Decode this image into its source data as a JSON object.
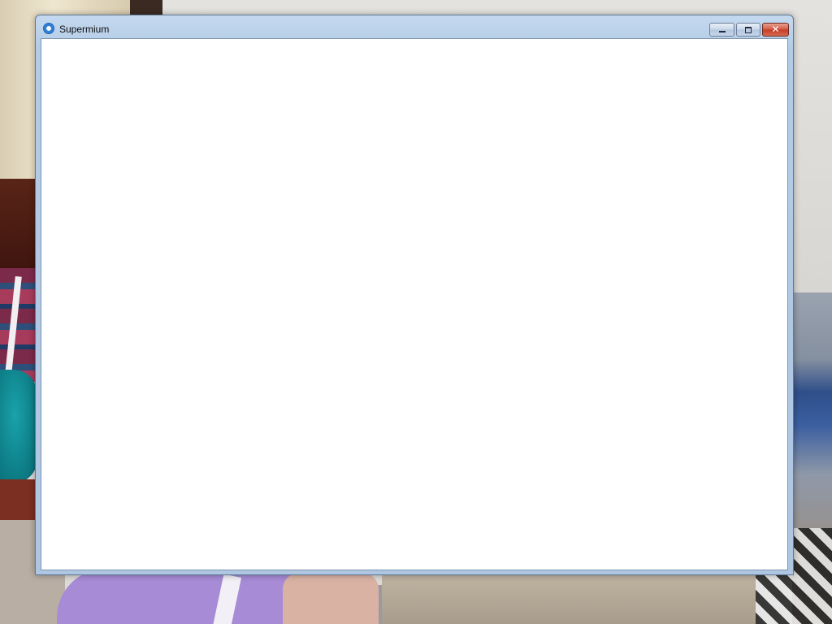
{
  "window": {
    "title": "Supermium",
    "app_icon": "supermium-app-icon",
    "controls": {
      "minimize_icon": "minimize-icon",
      "maximize_icon": "maximize-icon",
      "close_glyph": "✕"
    }
  },
  "client_area": {
    "state": "blank"
  },
  "colors": {
    "titlebar": "#b3cbe6",
    "close_button": "#c43d26",
    "client_background": "#ffffff"
  }
}
